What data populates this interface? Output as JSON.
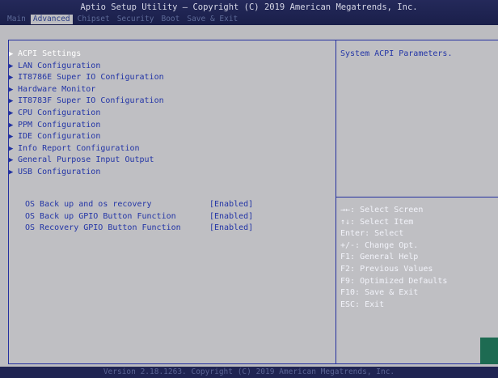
{
  "header": {
    "title": "Aptio Setup Utility – Copyright (C) 2019 American Megatrends, Inc.",
    "tabs": [
      {
        "label": "Main",
        "active": false
      },
      {
        "label": "Advanced",
        "active": true
      },
      {
        "label": "Chipset",
        "active": false
      },
      {
        "label": "Security",
        "active": false
      },
      {
        "label": "Boot",
        "active": false
      },
      {
        "label": "Save & Exit",
        "active": false
      }
    ]
  },
  "menu": {
    "items": [
      {
        "label": "ACPI Settings",
        "selected": true
      },
      {
        "label": "LAN Configuration"
      },
      {
        "label": "IT8786E Super IO Configuration"
      },
      {
        "label": "Hardware Monitor"
      },
      {
        "label": "IT8783F Super IO Configuration"
      },
      {
        "label": "CPU Configuration"
      },
      {
        "label": "PPM Configuration"
      },
      {
        "label": "IDE Configuration"
      },
      {
        "label": "Info Report Configuration"
      },
      {
        "label": "General Purpose Input Output"
      },
      {
        "label": "USB Configuration"
      }
    ],
    "options": [
      {
        "label": "OS Back up and os recovery",
        "value": "[Enabled]"
      },
      {
        "label": "OS Back up GPIO Button Function",
        "value": "[Enabled]"
      },
      {
        "label": "OS Recovery GPIO Button Function",
        "value": "[Enabled]"
      }
    ]
  },
  "help": {
    "description": "System ACPI Parameters.",
    "keys": [
      "→←: Select Screen",
      "↑↓: Select Item",
      "Enter: Select",
      "+/-: Change Opt.",
      "F1: General Help",
      "F2: Previous Values",
      "F9: Optimized Defaults",
      "F10: Save & Exit",
      "ESC: Exit"
    ]
  },
  "footer": {
    "text": "Version 2.18.1263. Copyright (C) 2019 American Megatrends, Inc."
  },
  "colors": {
    "background": "#bfbfc3",
    "text_blue": "#2335a6",
    "title_bar": "#24295a",
    "border": "#2430a0",
    "selected_text": "#ffffff"
  }
}
